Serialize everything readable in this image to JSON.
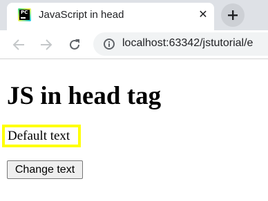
{
  "browser": {
    "tab": {
      "title": "JavaScript in head",
      "favicon": "pycharm-icon",
      "favicon_text": "PC",
      "close_icon": "close-icon"
    },
    "new_tab_icon": "plus-icon",
    "nav": {
      "back_icon": "back-arrow-icon",
      "forward_icon": "forward-arrow-icon",
      "reload_icon": "reload-icon"
    },
    "address": {
      "url": "localhost:63342/jstutorial/e",
      "info_icon": "info-icon"
    }
  },
  "page": {
    "heading": "JS in head tag",
    "text_box": "Default text",
    "button_label": "Change text"
  },
  "colors": {
    "highlight_border": "#ffff00",
    "tab_strip_bg": "#dee1e6",
    "omnibox_bg": "#f1f3f4"
  }
}
